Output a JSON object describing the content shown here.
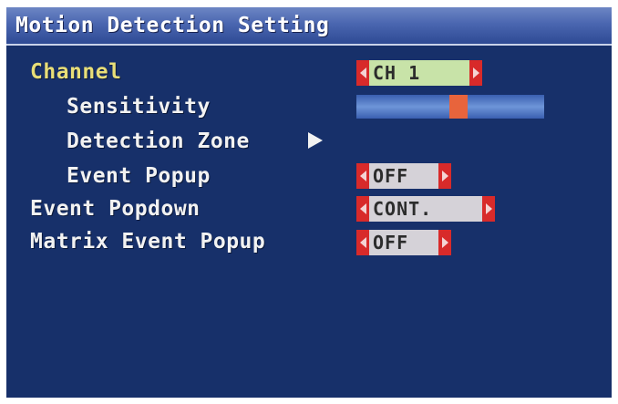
{
  "title": "Motion Detection Setting",
  "rows": {
    "channel": {
      "label": "Channel",
      "value": "CH 1"
    },
    "sensitivity": {
      "label": "Sensitivity",
      "level": 0.55
    },
    "detection_zone": {
      "label": "Detection Zone"
    },
    "event_popup": {
      "label": "Event Popup",
      "value": "OFF"
    },
    "event_popdown": {
      "label": "Event Popdown",
      "value": "CONT."
    },
    "matrix_event_popup": {
      "label": "Matrix Event Popup",
      "value": "OFF"
    }
  },
  "colors": {
    "background": "#17306a",
    "title_bar": "#4a66b0",
    "highlight_label": "#e8de78",
    "selector_cap": "#d82a2a",
    "selector_body": "#d5d2d8",
    "selected_selector_body": "#c8e3a8",
    "slider_knob": "#e8643c"
  },
  "icons": {
    "selector_left": "caret-left-icon",
    "selector_right": "caret-right-icon",
    "submenu": "play-arrow-icon"
  }
}
